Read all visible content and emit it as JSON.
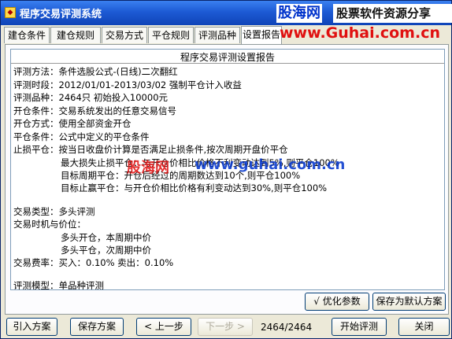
{
  "window": {
    "title": "程序交易评测系统"
  },
  "watermark": {
    "logo": "股海网",
    "slogan": "股票软件资源分享",
    "url": "www.Guhai.com.cn",
    "mid_logo": "股海网",
    "mid_url": "www.guhai.com.cn"
  },
  "tabs": [
    {
      "label": "建仓条件"
    },
    {
      "label": "建仓规则"
    },
    {
      "label": "交易方式"
    },
    {
      "label": "平仓规则"
    },
    {
      "label": "评测品种"
    },
    {
      "label": "设置报告"
    }
  ],
  "report": {
    "title": "程序交易评测设置报告",
    "lines": [
      "评测方法：条件选股公式-(日线)二次翻红",
      "评测时段：2012/01/01-2013/03/02 强制平仓计入收益",
      "评测品种：2464只 初始投入10000元",
      "开仓条件：交易系统发出的任意交易信号",
      "开仓方式：使用全部资金开仓",
      "平仓条件：公式中定义的平仓条件",
      "止损平仓：按当日收盘价计算是否满足止损条件,按次周期开盘价平仓",
      "最大损失止损平仓：与开仓价相比价格不利变动达到5%,则平仓100%",
      "目标周期平仓：开仓后经过的周期数达到10个,则平仓100%",
      "目标止赢平仓：与开仓价相比价格有利变动达到30%,则平仓100%",
      "交易类型：多头评测",
      "交易时机与价位：",
      "多头开仓，本周期中价",
      "多头平仓，次周期中价",
      "交易费率：买入：0.10%   卖出：0.10%",
      "评测模型：单品种评测"
    ]
  },
  "panel_buttons": {
    "optimize": "√ 优化参数",
    "save_default": "保存为默认方案"
  },
  "bottom": {
    "import": "引入方案",
    "save": "保存方案",
    "prev": "< 上一步",
    "next": "下一步 >",
    "status": "2464/2464",
    "start": "开始评测",
    "close": "关闭"
  }
}
